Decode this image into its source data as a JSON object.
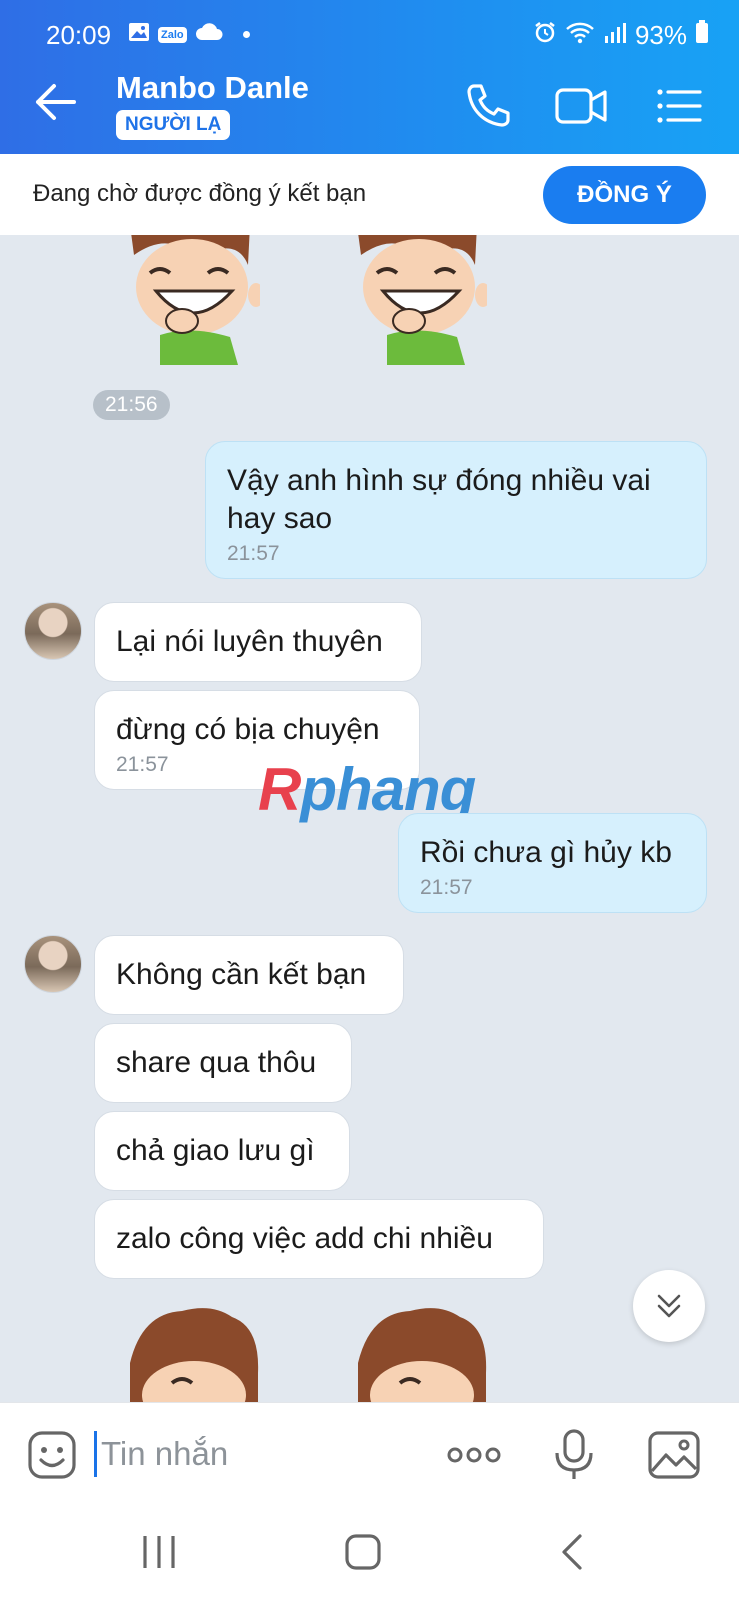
{
  "status_bar": {
    "time": "20:09",
    "zalo_badge": "Zalo",
    "battery": "93%"
  },
  "header": {
    "contact_name": "Manbo Danle",
    "stranger_tag": "NGƯỜI LẠ"
  },
  "friend_request": {
    "text": "Đang chờ được đồng ý kết bạn",
    "agree_label": "ĐỒNG Ý"
  },
  "messages": [
    {
      "dir": "pill",
      "time": "21:56"
    },
    {
      "dir": "out",
      "text_lines": [
        "Vậy anh hình sự đóng nhiều vai",
        "hay sao"
      ],
      "time": "21:57"
    },
    {
      "dir": "in",
      "text": "Lại nói luyên thuyên"
    },
    {
      "dir": "in",
      "text": "đừng có bịa chuyện",
      "time": "21:57"
    },
    {
      "dir": "out",
      "text": "Rồi chưa gì hủy kb",
      "time": "21:57"
    },
    {
      "dir": "in",
      "text": "Không cần kết bạn"
    },
    {
      "dir": "in",
      "text": "share qua thôu"
    },
    {
      "dir": "in",
      "text": "chả giao lưu gì"
    },
    {
      "dir": "in",
      "text": "zalo công việc add chi nhiều"
    }
  ],
  "watermark": "Rphang",
  "input": {
    "placeholder": "Tin nhắn"
  },
  "colors": {
    "header_start": "#2f6ee6",
    "header_end": "#18a2f5",
    "chat_bg": "#e2e8ef",
    "outgoing_bubble": "#d6f0fd",
    "accent": "#1a7df0"
  }
}
